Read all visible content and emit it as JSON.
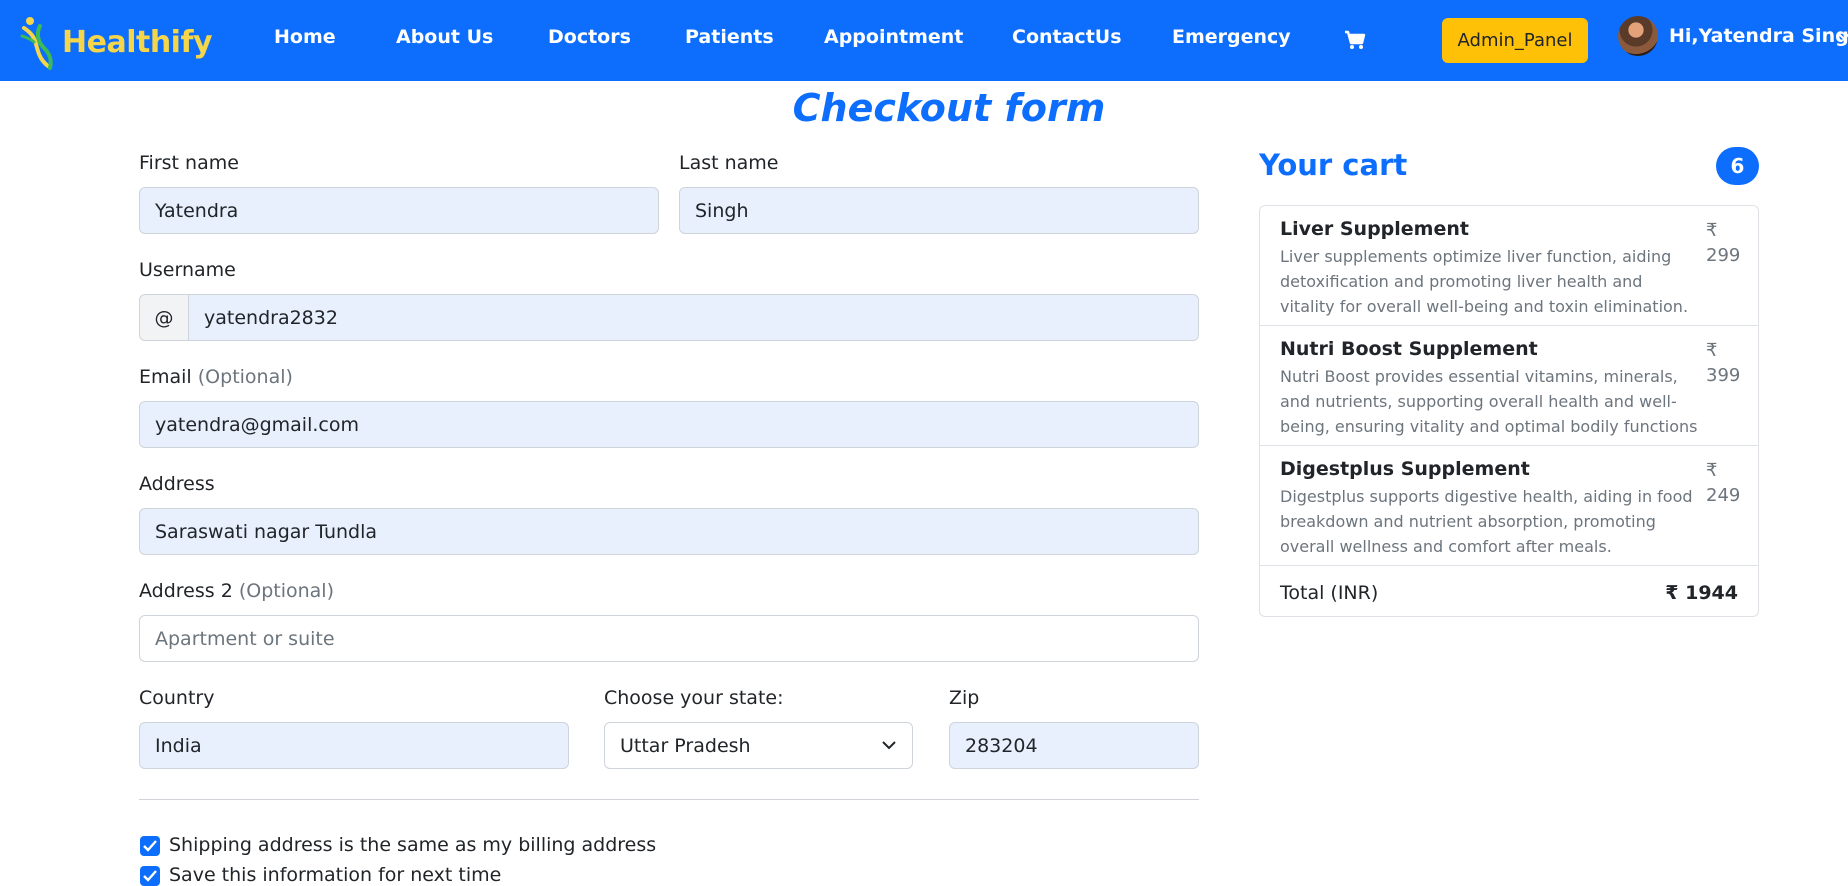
{
  "nav": {
    "brand": "Healthify",
    "links": [
      "Home",
      "About Us",
      "Doctors",
      "Patients",
      "Appointment",
      "ContactUs",
      "Emergency"
    ],
    "admin_label": "Admin_Panel",
    "user_greeting": "Hi,Yatendra Singh"
  },
  "page": {
    "title": "Checkout form"
  },
  "form": {
    "first_name": {
      "label": "First name",
      "value": "Yatendra"
    },
    "last_name": {
      "label": "Last name",
      "value": "Singh"
    },
    "username": {
      "label": "Username",
      "prefix": "@",
      "value": "yatendra2832"
    },
    "email": {
      "label": "Email",
      "optional": "(Optional)",
      "value": "yatendra@gmail.com"
    },
    "address": {
      "label": "Address",
      "value": "Saraswati nagar Tundla"
    },
    "address2": {
      "label": "Address 2",
      "optional": "(Optional)",
      "placeholder": "Apartment or suite"
    },
    "country": {
      "label": "Country",
      "value": "India"
    },
    "state": {
      "label": "Choose your state:",
      "value": "Uttar Pradesh"
    },
    "zip": {
      "label": "Zip",
      "value": "283204"
    },
    "checks": [
      {
        "label": "Shipping address is the same as my billing address",
        "checked": true
      },
      {
        "label": "Save this information for next time",
        "checked": true
      }
    ]
  },
  "cart": {
    "title": "Your cart",
    "count": "6",
    "items": [
      {
        "name": "Liver Supplement",
        "desc": "Liver supplements optimize liver function, aiding detoxification and promoting liver health and vitality for overall well-being and toxin elimination.",
        "currency": "₹",
        "price": "299"
      },
      {
        "name": "Nutri Boost Supplement",
        "desc": "Nutri Boost provides essential vitamins, minerals, and nutrients, supporting overall health and well-being, ensuring vitality and optimal bodily functions",
        "currency": "₹",
        "price": "399"
      },
      {
        "name": "Digestplus Supplement",
        "desc": "Digestplus supports digestive health, aiding in food breakdown and nutrient absorption, promoting overall wellness and comfort after meals.",
        "currency": "₹",
        "price": "249"
      }
    ],
    "total_label": "Total (INR)",
    "total_value": "₹ 1944"
  },
  "colors": {
    "primary": "#0d6efd",
    "admin": "#ffc107",
    "brand_text": "#f5d64a",
    "field_fill": "#e8f0fe"
  }
}
